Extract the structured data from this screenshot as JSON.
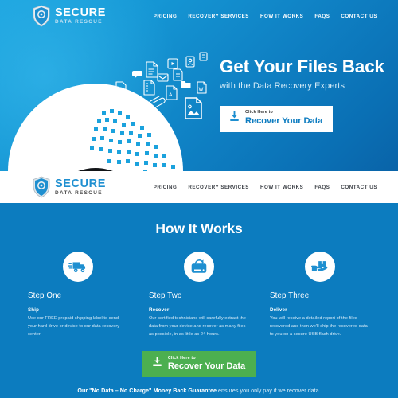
{
  "brand": {
    "name": "SECURE",
    "tagline": "DATA RESCUE",
    "shield_icon": "shield-icon",
    "accent_blue": "#0c7cbf",
    "accent_light_blue": "#1aa3de",
    "accent_green": "#4caf50"
  },
  "top_nav": {
    "links": [
      {
        "label": "PRICING",
        "name": "nav-link-pricing"
      },
      {
        "label": "RECOVERY SERVICES",
        "name": "nav-link-recovery-services"
      },
      {
        "label": "HOW IT WORKS",
        "name": "nav-link-how-it-works"
      },
      {
        "label": "FAQS",
        "name": "nav-link-faqs"
      },
      {
        "label": "CONTACT US",
        "name": "nav-link-contact-us"
      }
    ]
  },
  "white_nav": {
    "links": [
      {
        "label": "PRICING",
        "name": "nav-link-pricing"
      },
      {
        "label": "RECOVERY SERVICES",
        "name": "nav-link-recovery-services"
      },
      {
        "label": "HOW IT WORKS",
        "name": "nav-link-how-it-works"
      },
      {
        "label": "FAQS",
        "name": "nav-link-faqs"
      },
      {
        "label": "CONTACT US",
        "name": "nav-link-contact-us"
      }
    ]
  },
  "hero": {
    "title": "Get Your Files Back",
    "subtitle": "with the Data Recovery Experts",
    "cta": {
      "small": "Click Here to",
      "big": "Recover Your Data",
      "icon": "download-icon"
    },
    "illustration": {
      "disc_icon": "hard-disk-platter-icon",
      "file_icons": [
        "music-file-icon",
        "chat-bubble-icon",
        "document-file-icon",
        "zip-file-icon",
        "video-file-icon",
        "email-icon",
        "text-file-icon",
        "contact-card-icon",
        "folder-icon",
        "pdf-file-icon",
        "word-file-icon",
        "paperclip-icon",
        "image-file-icon"
      ]
    }
  },
  "how_it_works": {
    "title": "How It Works",
    "steps": [
      {
        "step_label": "Step One",
        "heading": "Ship",
        "body": "Use our FREE prepaid shipping label to send your hard drive or device to our data recovery center.",
        "icon": "delivery-truck-icon"
      },
      {
        "step_label": "Step Two",
        "heading": "Recover",
        "body": "Our certified technicians will carefully extract the data from your device and recover as many files as possible, in as little as 24 hours.",
        "icon": "hard-drive-restore-icon"
      },
      {
        "step_label": "Step Three",
        "heading": "Deliver",
        "body": "You will receive a detailed report of the files recovered and then we'll ship the recovered data to you on a secure USB flash drive.",
        "icon": "hand-holding-package-icon"
      }
    ],
    "cta": {
      "small": "Click Here to",
      "big": "Recover Your Data",
      "icon": "download-icon"
    },
    "guarantee_bold": "Our \"No Data – No Charge\" Money Back Guarantee",
    "guarantee_rest": " ensures you only pay if we recover data."
  }
}
